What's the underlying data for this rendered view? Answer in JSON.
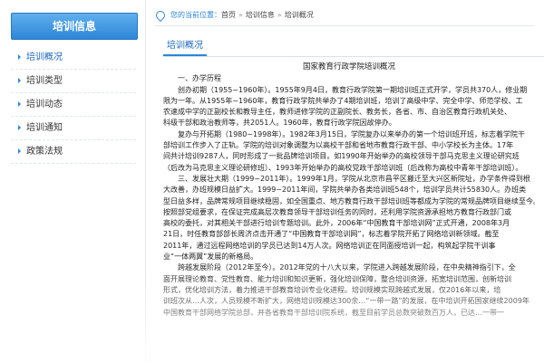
{
  "sidebar": {
    "header": "培训信息",
    "items": [
      {
        "label": "培训概况"
      },
      {
        "label": "培训类型"
      },
      {
        "label": "培训动态"
      },
      {
        "label": "培训通知"
      },
      {
        "label": "政策法规"
      }
    ]
  },
  "breadcrumb": {
    "prefix": "您的当前位置：",
    "items": [
      "首页",
      "培训信息",
      "培训概况"
    ],
    "sep": "»"
  },
  "content": {
    "tab": "培训概况",
    "title": "国家教育行政学院培训概况",
    "paragraphs": [
      {
        "cls": "heading",
        "text": "一、办学历程"
      },
      {
        "cls": "indent",
        "text": "创办初期（1955~1960年）。1955年9月4日，教育行政学院第一期培训班正式开学，学员共370人，修业期"
      },
      {
        "cls": "",
        "text": "限为一年。从1955年~1960年，教育行政学院共举办了4期培训班，培训了高级中学、完全中学、师范学校、工"
      },
      {
        "cls": "",
        "text": "农速成中学的正副校长和教导主任，教师进修学院的正副院长、教务长，各省、市、自治区教育行政机关处、"
      },
      {
        "cls": "",
        "text": "科级干部和政治教师等，共2051人。1960年，教育行政学院因故停办。"
      },
      {
        "cls": "indent",
        "text": "复办与开拓期（1980~1998年）。1982年3月15日，学院复办以来举办的第一个培训班开班，标志着学院干"
      },
      {
        "cls": "",
        "text": "部培训工作步入了正轨。学院的培训对象调整为以高校干部和省地市教育行政干部、中小学校长为主体。17年"
      },
      {
        "cls": "",
        "text": "间共计培训9287人，同时形成了一批品牌培训项目。如1990年开始举办的高校领导干部马克思主义理论研究班"
      },
      {
        "cls": "",
        "text": "（后改为马克思主义理论研修班）、1993年开始举办的高校党政干部培训班（后改称为高校中青年干部培训班）。"
      },
      {
        "cls": "indent",
        "text": "三、发展壮大期（1999~2011年）。1999年1月，学院从北京市昌平区搬迁至大兴区新院址，办学条件得到根"
      },
      {
        "cls": "",
        "text": "大改善，办班规模日益扩大。1999~2011年间，学院共举办各类培训班548个，培训学员共计55830人。办班类"
      },
      {
        "cls": "",
        "text": "型日益多样，品牌常规项目继续稳固，如全国重点、地方教育行政干部培训班等都成为学院的常规品牌项目继续至今。学院"
      },
      {
        "cls": "",
        "text": "按照部党组要求，在保证完成高层次教育领导干部培训任务的同时，还利用学院资源承担地方教育行政部门或"
      },
      {
        "cls": "",
        "text": "高校的委托，对其相关干部进行培训专题培训。此外，2006年“中国教育干部培训网”正式开通，2008年3月"
      },
      {
        "cls": "",
        "text": "21日，时任教育部部长周济点击开通了“中国教育干部培训网”，标志着学院开拓了网络培训新领域。截至"
      },
      {
        "cls": "",
        "text": "2011年，通过远程网络培训的学员已达到14万人次。网络培训正在同面授培训一起，构筑起学院干训事"
      },
      {
        "cls": "",
        "text": "业“一体两翼”发展的新格局。"
      },
      {
        "cls": "indent",
        "text": "跨越发展阶段（2012年至今）。2012年党的十八大以来，学院进入跨越发展阶段，在中央精神指引下，全"
      },
      {
        "cls": "",
        "text": "面开展理论教育、党性教育、能力培训和知识更新，强化培训保障，整合培训资源，拓宽培训范围，创新培训"
      },
      {
        "cls": "",
        "text": "形式，优化培训方法，着力推进干部教育培训专业化进程。培训规模实现跨越式发展，仅2016年以来，培"
      },
      {
        "cls": "",
        "text": "训班次从…人次，人员规模不断扩大，网络培训规模达300余…“一带一路”的发展，在中培训开拓国家继续2009年"
      },
      {
        "cls": "",
        "text": "中国教育干部网络学院总部，并各省教育干部培训院系统，截至目前学员总数突破数百万人，已达…一带一"
      }
    ]
  }
}
